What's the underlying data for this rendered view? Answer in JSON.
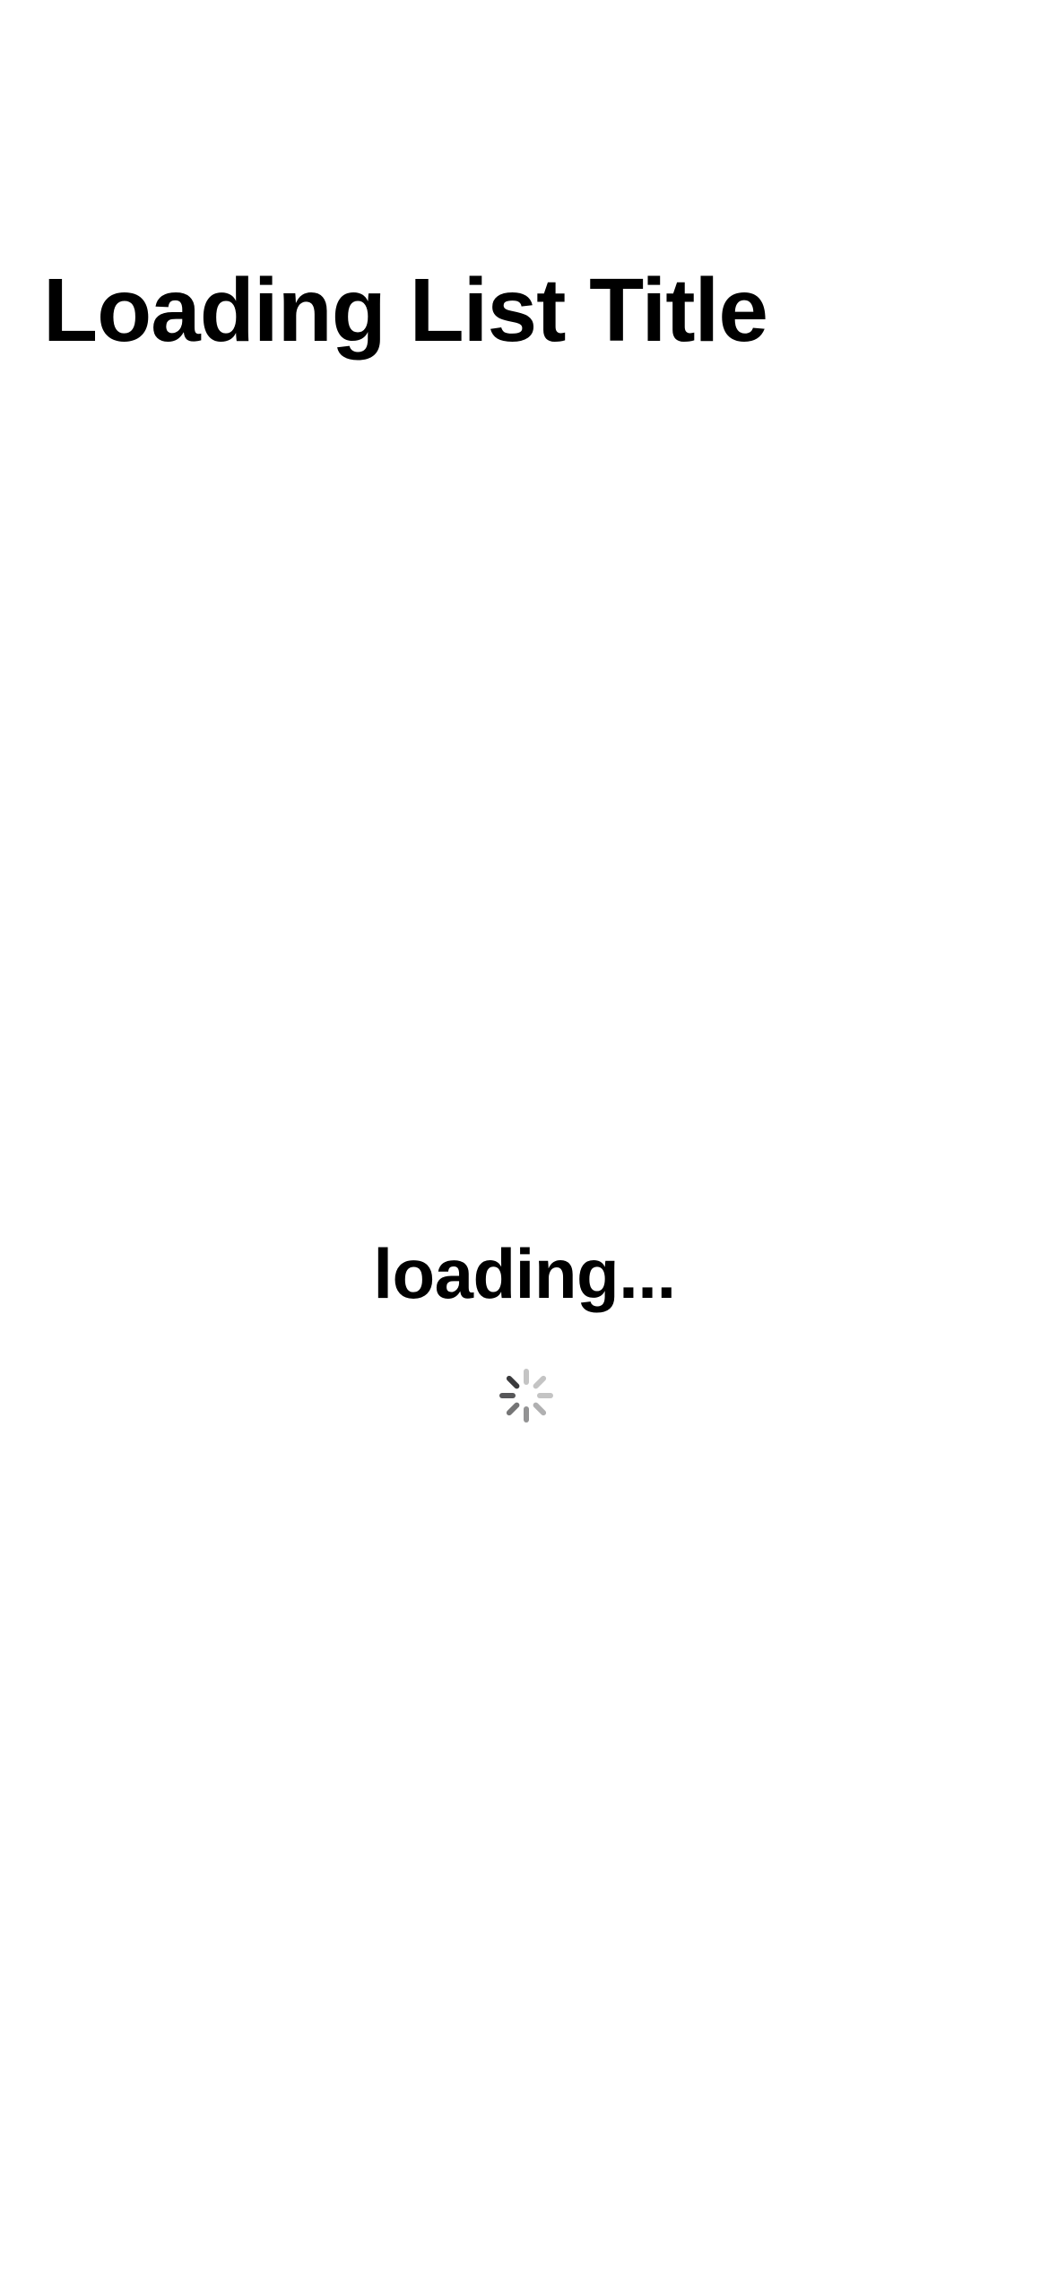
{
  "navigation": {
    "title": "Loading List Title"
  },
  "loading": {
    "label": "loading...",
    "indicator_icon": "activity-spinner-icon"
  },
  "colors": {
    "background": "#ffffff",
    "text": "#000000",
    "spinner_dark": "#3a3a3c",
    "spinner_light": "#c7c7cc"
  }
}
